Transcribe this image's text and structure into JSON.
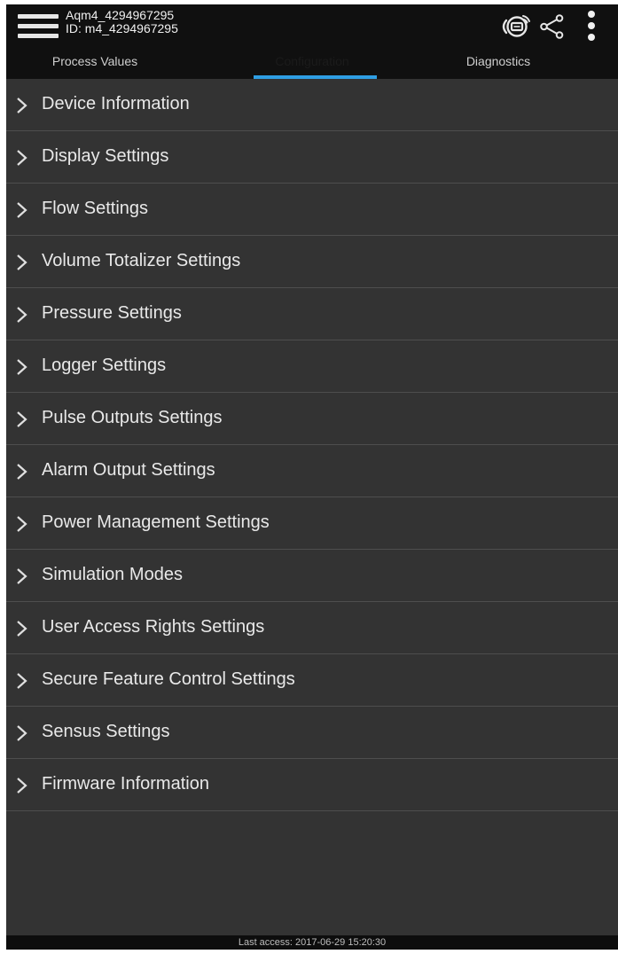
{
  "header": {
    "device_name": "Aqm4_4294967295",
    "device_id": "ID: m4_4294967295"
  },
  "icons": {
    "menu": "hamburger-menu-icon",
    "nfc": "nfc-icon",
    "share": "share-icon",
    "overflow": "more-vertical-icon"
  },
  "tabs": [
    {
      "label": "Process Values",
      "active": false
    },
    {
      "label": "Configuration",
      "active": true
    },
    {
      "label": "Diagnostics",
      "active": false
    }
  ],
  "menu": {
    "items": [
      {
        "label": "Device Information"
      },
      {
        "label": "Display Settings"
      },
      {
        "label": "Flow Settings"
      },
      {
        "label": "Volume Totalizer Settings"
      },
      {
        "label": "Pressure Settings"
      },
      {
        "label": "Logger Settings"
      },
      {
        "label": "Pulse Outputs Settings"
      },
      {
        "label": "Alarm Output Settings"
      },
      {
        "label": "Power Management Settings"
      },
      {
        "label": "Simulation Modes"
      },
      {
        "label": "User Access Rights Settings"
      },
      {
        "label": "Secure Feature Control Settings"
      },
      {
        "label": "Sensus Settings"
      },
      {
        "label": "Firmware Information"
      }
    ]
  },
  "footer": {
    "last_access": "Last access: 2017-06-29 15:20:30"
  },
  "colors": {
    "app_bar": "#101010",
    "background": "#333333",
    "tab_indicator": "#2f9ee3",
    "divider": "#4e4e4e"
  }
}
